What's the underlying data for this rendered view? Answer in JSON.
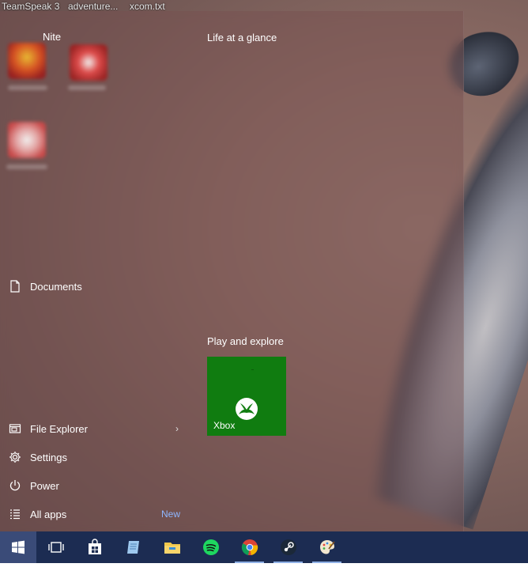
{
  "desktop": {
    "top_labels": [
      "TeamSpeak 3",
      "adventure...",
      "xcom.txt"
    ]
  },
  "start_menu": {
    "user_name": "Nite",
    "left_items": {
      "documents": "Documents",
      "file_explorer": "File Explorer",
      "file_explorer_arrow": "›",
      "settings": "Settings",
      "power": "Power",
      "all_apps": "All apps",
      "all_apps_badge": "New"
    },
    "groups": {
      "life_at_a_glance": "Life at a glance",
      "play_and_explore": "Play and explore"
    },
    "tiles": [
      {
        "label": "Xbox",
        "color": "#107c10",
        "icon": "xbox-icon"
      }
    ]
  },
  "taskbar": {
    "items": [
      {
        "name": "start-button",
        "icon": "windows-logo-icon"
      },
      {
        "name": "task-view-button",
        "icon": "task-view-icon"
      },
      {
        "name": "store-button",
        "icon": "store-icon"
      },
      {
        "name": "notepad-button",
        "icon": "notepad-icon"
      },
      {
        "name": "file-explorer-button",
        "icon": "folder-icon"
      },
      {
        "name": "spotify-button",
        "icon": "spotify-icon"
      },
      {
        "name": "chrome-button",
        "icon": "chrome-icon"
      },
      {
        "name": "steam-button",
        "icon": "steam-icon"
      },
      {
        "name": "paint-button",
        "icon": "paint-icon"
      }
    ],
    "background": "#1c2c52"
  }
}
